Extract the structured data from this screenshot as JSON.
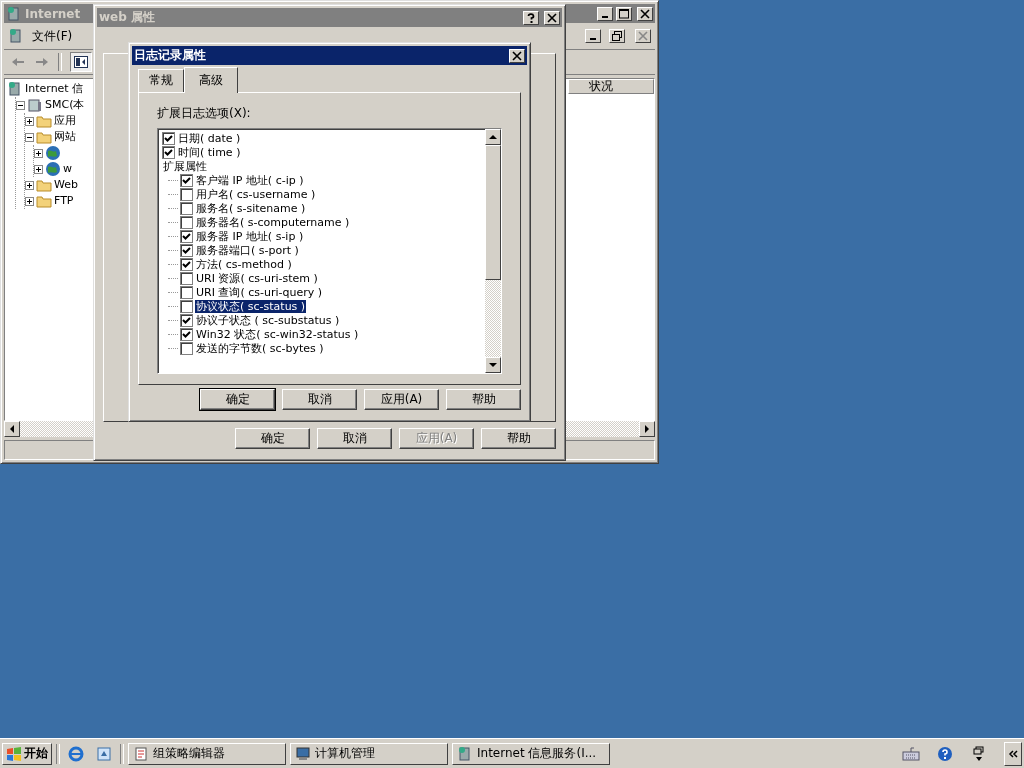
{
  "mmc_window": {
    "title": "Internet",
    "menu": [
      "文件(F)"
    ],
    "tree": [
      {
        "label": "Internet 信",
        "kind": "root",
        "children": [
          {
            "label": "SMC(本",
            "kind": "computer",
            "expanded": true,
            "children": [
              {
                "label": "应用",
                "kind": "folder",
                "expanded": false
              },
              {
                "label": "网站",
                "kind": "folder",
                "expanded": true,
                "children": [
                  {
                    "kind": "site",
                    "expanded": false
                  },
                  {
                    "label": "w",
                    "kind": "site",
                    "expanded": false
                  }
                ]
              },
              {
                "label": "Web",
                "kind": "folder",
                "expanded": false
              },
              {
                "label": "FTP",
                "kind": "folder",
                "expanded": false
              }
            ]
          }
        ]
      }
    ],
    "columns": [
      "状况"
    ]
  },
  "web_dialog": {
    "title": "web 属性",
    "buttons": [
      {
        "label": "确定",
        "disabled": false,
        "default": false
      },
      {
        "label": "取消",
        "disabled": false,
        "default": false
      },
      {
        "label": "应用(A)",
        "disabled": true,
        "default": false
      },
      {
        "label": "帮助",
        "disabled": false,
        "default": false
      }
    ]
  },
  "log_dialog": {
    "title": "日志记录属性",
    "tabs": [
      {
        "label": "常规",
        "selected": false
      },
      {
        "label": "高级",
        "selected": true
      }
    ],
    "options_label": "扩展日志选项(X):",
    "options": [
      {
        "kind": "check",
        "label": "日期( date )",
        "checked": true,
        "selected": false
      },
      {
        "kind": "check",
        "label": "时间( time )",
        "checked": true,
        "selected": false
      },
      {
        "kind": "group",
        "label": "扩展属性",
        "selected": false,
        "children": [
          {
            "kind": "check",
            "label": "客户端 IP 地址( c-ip )",
            "checked": true,
            "selected": false
          },
          {
            "kind": "check",
            "label": "用户名( cs-username )",
            "checked": false,
            "selected": false
          },
          {
            "kind": "check",
            "label": "服务名( s-sitename )",
            "checked": false,
            "selected": false
          },
          {
            "kind": "check",
            "label": "服务器名( s-computername )",
            "checked": false,
            "selected": false
          },
          {
            "kind": "check",
            "label": "服务器 IP 地址( s-ip )",
            "checked": true,
            "selected": false
          },
          {
            "kind": "check",
            "label": "服务器端口( s-port )",
            "checked": true,
            "selected": false
          },
          {
            "kind": "check",
            "label": "方法( cs-method )",
            "checked": true,
            "selected": false
          },
          {
            "kind": "check",
            "label": "URI 资源( cs-uri-stem )",
            "checked": false,
            "selected": false
          },
          {
            "kind": "check",
            "label": "URI 查询( cs-uri-query )",
            "checked": false,
            "selected": false
          },
          {
            "kind": "check",
            "label": "协议状态( sc-status )",
            "checked": false,
            "selected": true
          },
          {
            "kind": "check",
            "label": "协议子状态 ( sc-substatus )",
            "checked": true,
            "selected": false
          },
          {
            "kind": "check",
            "label": "Win32 状态( sc-win32-status )",
            "checked": true,
            "selected": false
          },
          {
            "kind": "check",
            "label": "发送的字节数( sc-bytes )",
            "checked": false,
            "selected": false
          }
        ]
      }
    ],
    "buttons": [
      {
        "label": "确定",
        "disabled": false,
        "default": true
      },
      {
        "label": "取消",
        "disabled": false,
        "default": false
      },
      {
        "label": "应用(A)",
        "disabled": false,
        "default": false
      },
      {
        "label": "帮助",
        "disabled": false,
        "default": false
      }
    ]
  },
  "taskbar": {
    "start": "开始",
    "tasks": [
      {
        "label": "组策略编辑器",
        "kind": "policy",
        "selected": false
      },
      {
        "label": "计算机管理",
        "kind": "computer",
        "selected": false
      },
      {
        "label": "Internet 信息服务(I...",
        "kind": "iis",
        "selected": false
      }
    ]
  }
}
